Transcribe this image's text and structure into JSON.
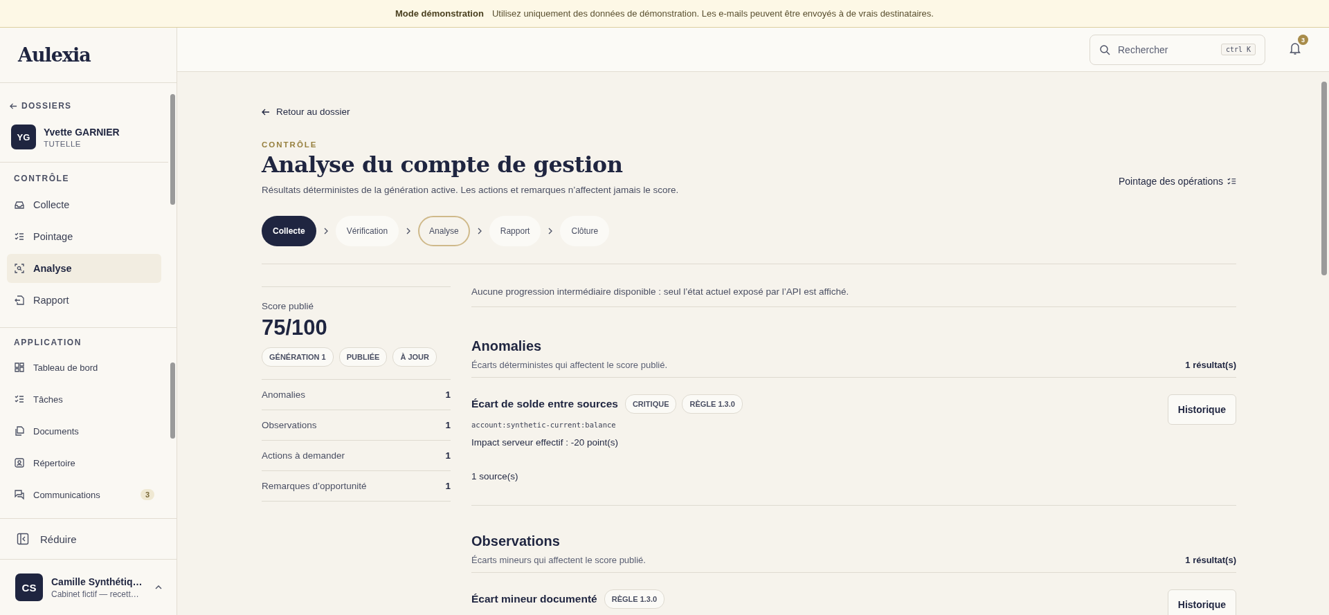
{
  "banner": {
    "title": "Mode démonstration",
    "message": "Utilisez uniquement des données de démonstration. Les e-mails peuvent être envoyés à de vrais destinataires."
  },
  "sidebar": {
    "logo": "Aulexia",
    "back_link": "DOSSIERS",
    "client": {
      "initials": "YG",
      "name": "Yvette GARNIER",
      "role": "TUTELLE"
    },
    "control_section": {
      "title": "CONTRÔLE",
      "items": [
        {
          "label": "Collecte",
          "selected": false
        },
        {
          "label": "Pointage",
          "selected": false
        },
        {
          "label": "Analyse",
          "selected": true
        },
        {
          "label": "Rapport",
          "selected": false
        }
      ]
    },
    "app_section": {
      "title": "APPLICATION",
      "items": [
        {
          "label": "Tableau de bord",
          "selected": false
        },
        {
          "label": "Tâches",
          "selected": false
        },
        {
          "label": "Documents",
          "selected": false
        },
        {
          "label": "Répertoire",
          "selected": false
        },
        {
          "label": "Communications",
          "selected": false,
          "badge": "3"
        }
      ]
    },
    "collapse": "Réduire",
    "user": {
      "initials": "CS",
      "name": "Camille Synthétiq…",
      "org": "Cabinet fictif — recett…"
    }
  },
  "topbar": {
    "search": {
      "placeholder": "Rechercher",
      "shortcut": "ctrl K"
    },
    "notifications": "3"
  },
  "page": {
    "back_link": "Retour au dossier",
    "eyebrow": "CONTRÔLE",
    "title": "Analyse du compte de gestion",
    "subtitle": "Résultats déterministes de la génération active. Les actions et remarques n’affectent jamais le score.",
    "action": "Pointage des opérations",
    "steps": [
      {
        "label": "Collecte",
        "completed": true,
        "selected": false
      },
      {
        "label": "Vérification",
        "completed": false,
        "selected": false
      },
      {
        "label": "Analyse",
        "completed": false,
        "selected": true
      },
      {
        "label": "Rapport",
        "completed": false,
        "selected": false
      },
      {
        "label": "Clôture",
        "completed": false,
        "selected": false
      }
    ]
  },
  "summary": {
    "label": "Score publié",
    "score": "75/100",
    "tags": [
      "GÉNÉRATION 1",
      "PUBLIÉE",
      "À JOUR"
    ],
    "counts": [
      {
        "label": "Anomalies",
        "value": "1"
      },
      {
        "label": "Observations",
        "value": "1"
      },
      {
        "label": "Actions à demander",
        "value": "1"
      },
      {
        "label": "Remarques d’opportunité",
        "value": "1"
      }
    ]
  },
  "notice": "Aucune progression intermédiaire disponible : seul l’état actuel exposé par l’API est affiché.",
  "sections": [
    {
      "title": "Anomalies",
      "description": "Écarts déterministes qui affectent le score publié.",
      "count": "1 résultat(s)",
      "findings": [
        {
          "title": "Écart de solde entre sources",
          "tags": [
            "CRITIQUE",
            "RÈGLE 1.3.0"
          ],
          "code": "account:synthetic-current:balance",
          "impact": "Impact serveur effectif : -20 point(s)",
          "sources": "1 source(s)",
          "button": "Historique"
        }
      ]
    },
    {
      "title": "Observations",
      "description": "Écarts mineurs qui affectent le score publié.",
      "count": "1 résultat(s)",
      "findings": [
        {
          "title": "Écart mineur documenté",
          "tags": [
            "RÈGLE 1.3.0"
          ],
          "button": "Historique"
        }
      ]
    }
  ]
}
